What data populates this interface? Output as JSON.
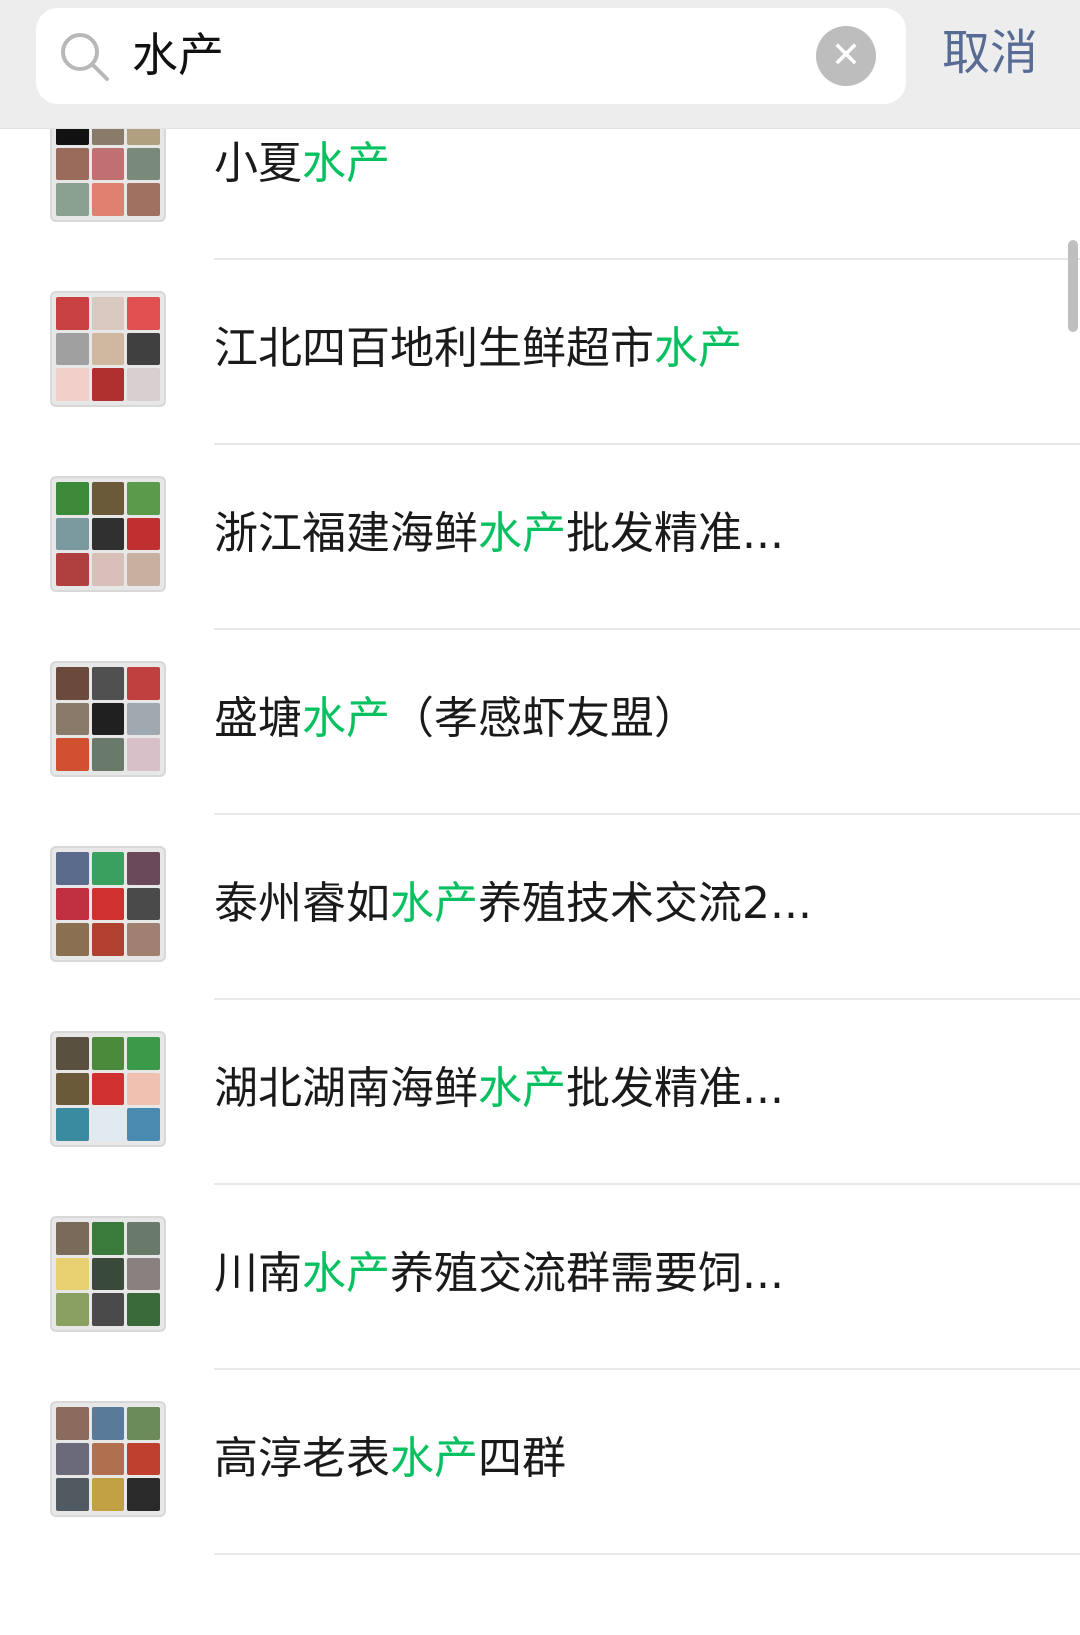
{
  "search": {
    "query": "水产",
    "cancel_label": "取消"
  },
  "results": [
    {
      "prefix": "小夏",
      "keyword": "水产",
      "suffix": ""
    },
    {
      "prefix": "江北四百地利生鲜超市",
      "keyword": "水产",
      "suffix": ""
    },
    {
      "prefix": "浙江福建海鲜",
      "keyword": "水产",
      "suffix": "批发精准..."
    },
    {
      "prefix": "盛塘",
      "keyword": "水产",
      "suffix": "（孝感虾友盟）"
    },
    {
      "prefix": "泰州睿如",
      "keyword": "水产",
      "suffix": "养殖技术交流2..."
    },
    {
      "prefix": "湖北湖南海鲜",
      "keyword": "水产",
      "suffix": "批发精准..."
    },
    {
      "prefix": "川南",
      "keyword": "水产",
      "suffix": "养殖交流群需要饲..."
    },
    {
      "prefix": "高淳老表",
      "keyword": "水产",
      "suffix": "四群"
    }
  ],
  "colors": {
    "highlight": "#07c160",
    "cancel": "#576b95",
    "topbar": "#ededed"
  }
}
